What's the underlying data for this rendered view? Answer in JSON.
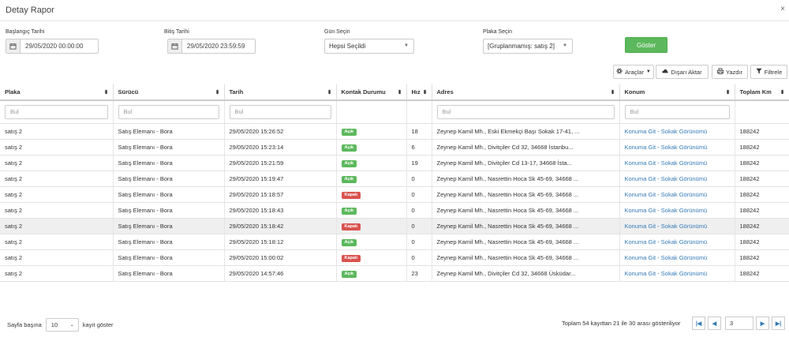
{
  "modal": {
    "title": "Detay Rapor",
    "close": "×"
  },
  "filters": {
    "start_label": "Başlangıç Tarihi",
    "start_value": "29/05/2020 00:00:00",
    "end_label": "Bitiş Tarihi",
    "end_value": "29/05/2020 23:59:59",
    "day_label": "Gün Seçin",
    "day_value": "Hepsi Seçildi",
    "plate_label": "Plaka Seçin",
    "plate_value": "[Gruplanmamış: satış 2]",
    "show_button": "Göster"
  },
  "toolbar": {
    "tools": "Araçlar",
    "export": "Dışarı Aktar",
    "print": "Yazdır",
    "filter": "Filtrele"
  },
  "table": {
    "columns": [
      "Plaka",
      "Sürücü",
      "Tarih",
      "Kontak Durumu",
      "Hız",
      "Adres",
      "Konum",
      "Toplam Km"
    ],
    "filter_placeholder": "Bul",
    "rows": [
      {
        "plate": "satış 2",
        "driver": "Satış Elemanı - Bora",
        "date": "29/05/2020 15:26:52",
        "status": "Açık",
        "speed": "18",
        "address": "Zeynep Kamil Mh., Eski Ekmekçi Başı Sokak 17-41, ...",
        "location": "Konuma Git - Sokak Görünümü",
        "km": "188242"
      },
      {
        "plate": "satış 2",
        "driver": "Satış Elemanı - Bora",
        "date": "29/05/2020 15:23:14",
        "status": "Açık",
        "speed": "6",
        "address": "Zeynep Kamil Mh., Divitçiler Cd 32, 34668 İstanbu...",
        "location": "Konuma Git - Sokak Görünümü",
        "km": "188242"
      },
      {
        "plate": "satış 2",
        "driver": "Satış Elemanı - Bora",
        "date": "29/05/2020 15:21:59",
        "status": "Açık",
        "speed": "19",
        "address": "Zeynep Kamil Mh., Divitçiler Cd 13-17, 34668 İsta...",
        "location": "Konuma Git - Sokak Görünümü",
        "km": "188242"
      },
      {
        "plate": "satış 2",
        "driver": "Satış Elemanı - Bora",
        "date": "29/05/2020 15:19:47",
        "status": "Açık",
        "speed": "0",
        "address": "Zeynep Kamil Mh., Nasrettin Hoca Sk 45-69, 34668 ...",
        "location": "Konuma Git - Sokak Görünümü",
        "km": "188242"
      },
      {
        "plate": "satış 2",
        "driver": "Satış Elemanı - Bora",
        "date": "29/05/2020 15:18:57",
        "status": "Kapalı",
        "speed": "0",
        "address": "Zeynep Kamil Mh., Nasrettin Hoca Sk 45-69, 34668 ...",
        "location": "Konuma Git - Sokak Görünümü",
        "km": "188242"
      },
      {
        "plate": "satış 2",
        "driver": "Satış Elemanı - Bora",
        "date": "29/05/2020 15:18:43",
        "status": "Açık",
        "speed": "0",
        "address": "Zeynep Kamil Mh., Nasrettin Hoca Sk 45-69, 34668 ...",
        "location": "Konuma Git - Sokak Görünümü",
        "km": "188242"
      },
      {
        "plate": "satış 2",
        "driver": "Satış Elemanı - Bora",
        "date": "29/05/2020 15:18:42",
        "status": "Kapalı",
        "speed": "0",
        "address": "Zeynep Kamil Mh., Nasrettin Hoca Sk 45-69, 34668 ...",
        "location": "Konuma Git - Sokak Görünümü",
        "km": "188242"
      },
      {
        "plate": "satış 2",
        "driver": "Satış Elemanı - Bora",
        "date": "29/05/2020 15:18:12",
        "status": "Açık",
        "speed": "0",
        "address": "Zeynep Kamil Mh., Nasrettin Hoca Sk 45-69, 34668 ...",
        "location": "Konuma Git - Sokak Görünümü",
        "km": "188242"
      },
      {
        "plate": "satış 2",
        "driver": "Satış Elemanı - Bora",
        "date": "29/05/2020 15:00:02",
        "status": "Kapalı",
        "speed": "0",
        "address": "Zeynep Kamil Mh., Nasrettin Hoca Sk 45-69, 34668 ...",
        "location": "Konuma Git - Sokak Görünümü",
        "km": "188242"
      },
      {
        "plate": "satış 2",
        "driver": "Satış Elemanı - Bora",
        "date": "29/05/2020 14:57:46",
        "status": "Açık",
        "speed": "23",
        "address": "Zeynep Kamil Mh., Divitçiler Cd 32, 34668 Üsküdar...",
        "location": "Konuma Git - Sokak Görünümü",
        "km": "188242"
      }
    ]
  },
  "footer": {
    "per_page_prefix": "Sayfa başına",
    "per_page_value": "10",
    "per_page_suffix": "kayıt göster",
    "info": "Toplam 54 kayıttan 21 ile 30 arası gösteriliyor",
    "page_value": "3"
  },
  "colors": {
    "open": "#5cb85c",
    "closed": "#d9534f",
    "link": "#337ab7"
  }
}
